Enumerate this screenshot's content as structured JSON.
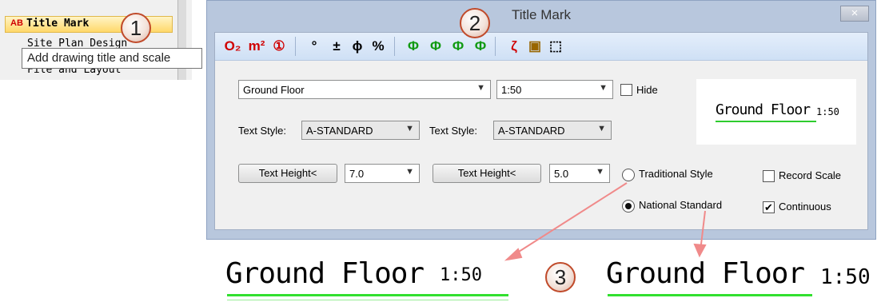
{
  "menu": {
    "item_highlighted": {
      "badge": "AB",
      "label": "Title Mark"
    },
    "item_below": "Site Plan Design",
    "item_third": "File and Layout",
    "tooltip": "Add drawing title and scale"
  },
  "steps": [
    "1",
    "2",
    "3"
  ],
  "dialog": {
    "title": "Title Mark",
    "close_glyph": "×",
    "toolbar": {
      "buttons": [
        {
          "name": "o2-subscript-icon",
          "glyph": "O₂",
          "color": "#d00000"
        },
        {
          "name": "m2-superscript-icon",
          "glyph": "m²",
          "color": "#d00000"
        },
        {
          "name": "circled-one-icon",
          "glyph": "①",
          "color": "#d00000"
        },
        {
          "name": "degree-icon",
          "glyph": "°",
          "color": "#000000"
        },
        {
          "name": "plus-minus-icon",
          "glyph": "±",
          "color": "#000000"
        },
        {
          "name": "diameter-icon",
          "glyph": "ϕ",
          "color": "#000000"
        },
        {
          "name": "percent-icon",
          "glyph": "%",
          "color": "#000000"
        },
        {
          "name": "rebar-grade-1-icon",
          "glyph": "Φ",
          "color": "#119a11"
        },
        {
          "name": "rebar-grade-2-icon",
          "glyph": "Φ",
          "color": "#119a11"
        },
        {
          "name": "rebar-grade-3-icon",
          "glyph": "Ф",
          "color": "#119a11"
        },
        {
          "name": "rebar-grade-4-icon",
          "glyph": "Ф",
          "color": "#119a11"
        },
        {
          "name": "special-symbol-icon",
          "glyph": "ζ",
          "color": "#d00000"
        },
        {
          "name": "symbol-library-icon",
          "glyph": "▣",
          "color": "#996600"
        },
        {
          "name": "pick-text-icon",
          "glyph": "⬚",
          "color": "#000000"
        }
      ]
    },
    "title_combo": {
      "value": "Ground Floor"
    },
    "scale_combo": {
      "value": "1:50"
    },
    "hide_label": "Hide",
    "text_style_label_1": "Text Style:",
    "text_style_value_1": "A-STANDARD",
    "text_style_label_2": "Text Style:",
    "text_style_value_2": "A-STANDARD",
    "text_height_btn_1": "Text Height<",
    "text_height_value_1": "7.0",
    "text_height_btn_2": "Text Height<",
    "text_height_value_2": "5.0",
    "radio_traditional": "Traditional Style",
    "radio_national": "National Standard",
    "record_scale": "Record Scale",
    "continuous": "Continuous",
    "continuous_checked": true,
    "preview": {
      "title": "Ground Floor",
      "scale": "1:50"
    }
  },
  "samples": {
    "left": {
      "title": "Ground Floor",
      "scale": "1:50"
    },
    "right": {
      "title": "Ground Floor",
      "scale": "1:50"
    }
  },
  "colors": {
    "underline": "#32e02f",
    "arrow": "#f08a8a"
  }
}
